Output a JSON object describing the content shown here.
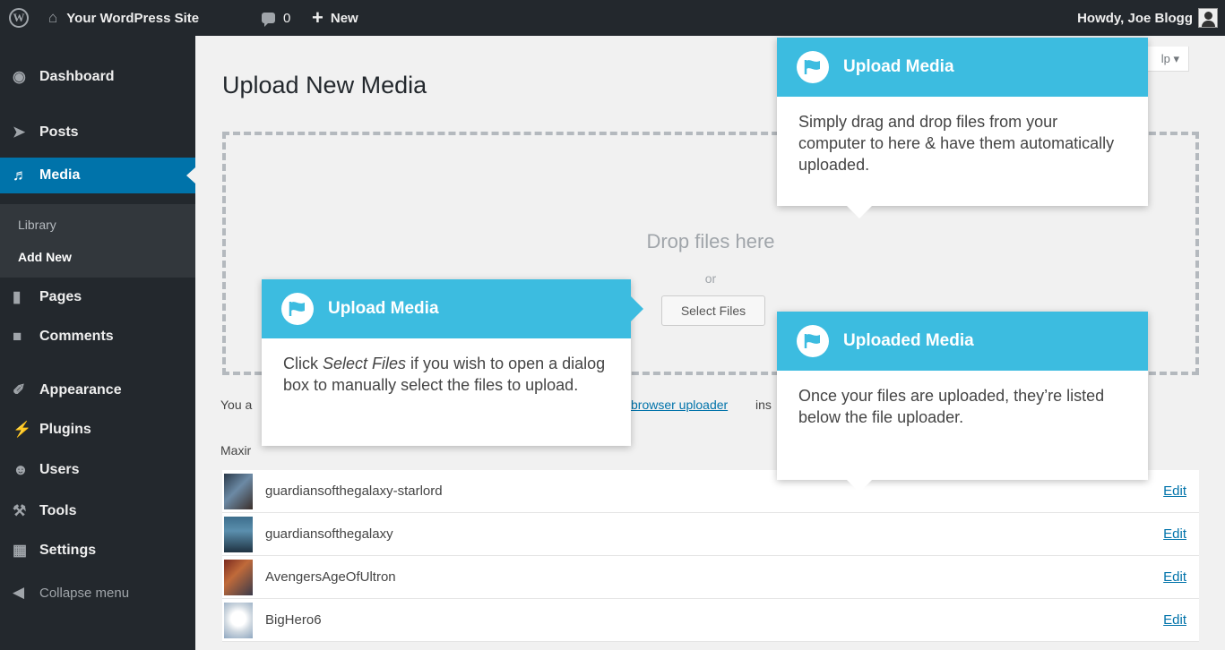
{
  "admin_bar": {
    "wp_logo_icon": "wordpress-logo-icon",
    "site_name": "Your WordPress Site",
    "comments_count": "0",
    "new_label": "New",
    "howdy": "Howdy, Joe Blogg"
  },
  "sidebar": {
    "items": [
      {
        "label": "Dashboard",
        "icon": "dashboard-icon"
      },
      {
        "label": "Posts",
        "icon": "pin-icon"
      },
      {
        "label": "Media",
        "icon": "media-icon"
      },
      {
        "label": "Pages",
        "icon": "pages-icon"
      },
      {
        "label": "Comments",
        "icon": "comment-icon"
      },
      {
        "label": "Appearance",
        "icon": "paintbrush-icon"
      },
      {
        "label": "Plugins",
        "icon": "plug-icon"
      },
      {
        "label": "Users",
        "icon": "users-icon"
      },
      {
        "label": "Tools",
        "icon": "wrench-icon"
      },
      {
        "label": "Settings",
        "icon": "settings-icon"
      }
    ],
    "submenu": [
      "Library",
      "Add New"
    ],
    "collapse_label": "Collapse menu"
  },
  "main": {
    "page_title": "Upload New Media",
    "help_label": "lp ▾",
    "drop_text": "Drop files here",
    "or_text": "or",
    "select_files": "Select Files",
    "info_prefix": "You a",
    "info_link": "browser uploader",
    "info_suffix": "ins",
    "max_upload": "Maxir"
  },
  "media": [
    {
      "name": "guardiansofthegalaxy-starlord",
      "edit": "Edit"
    },
    {
      "name": "guardiansofthegalaxy",
      "edit": "Edit"
    },
    {
      "name": "AvengersAgeOfUltron",
      "edit": "Edit"
    },
    {
      "name": "BigHero6",
      "edit": "Edit"
    }
  ],
  "pointers": {
    "drag": {
      "title": "Upload Media",
      "body": "Simply drag and drop files from your computer to here & have them automatically uploaded."
    },
    "select": {
      "title": "Upload Media",
      "body_pre": "Click ",
      "body_em": "Select Files",
      "body_post": " if you wish to open a dialog box to manually select the files to upload."
    },
    "uploaded": {
      "title": "Uploaded Media",
      "body": "Once your files are uploaded, they’re listed below the file uploader."
    }
  },
  "colors": {
    "admin_bg": "#23282d",
    "accent": "#0073aa",
    "pointer_header": "#3cbce0"
  }
}
